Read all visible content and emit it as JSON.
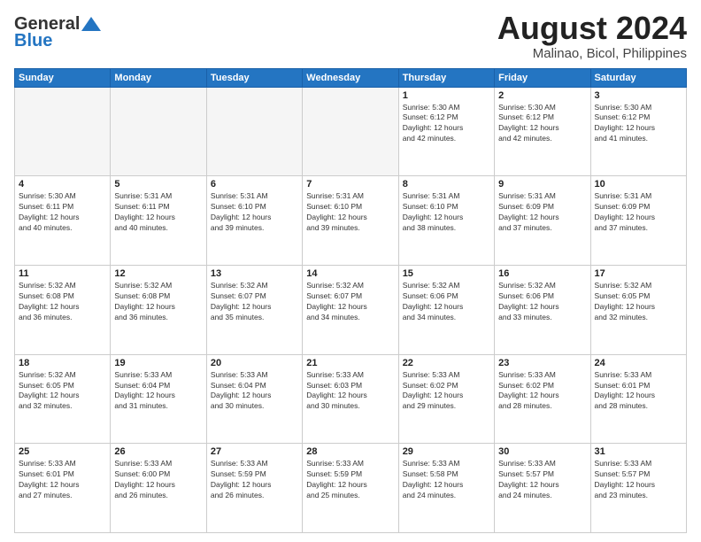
{
  "header": {
    "logo_line1": "General",
    "logo_line2": "Blue",
    "title": "August 2024",
    "subtitle": "Malinao, Bicol, Philippines"
  },
  "weekdays": [
    "Sunday",
    "Monday",
    "Tuesday",
    "Wednesday",
    "Thursday",
    "Friday",
    "Saturday"
  ],
  "weeks": [
    [
      {
        "day": "",
        "info": ""
      },
      {
        "day": "",
        "info": ""
      },
      {
        "day": "",
        "info": ""
      },
      {
        "day": "",
        "info": ""
      },
      {
        "day": "1",
        "info": "Sunrise: 5:30 AM\nSunset: 6:12 PM\nDaylight: 12 hours\nand 42 minutes."
      },
      {
        "day": "2",
        "info": "Sunrise: 5:30 AM\nSunset: 6:12 PM\nDaylight: 12 hours\nand 42 minutes."
      },
      {
        "day": "3",
        "info": "Sunrise: 5:30 AM\nSunset: 6:12 PM\nDaylight: 12 hours\nand 41 minutes."
      }
    ],
    [
      {
        "day": "4",
        "info": "Sunrise: 5:30 AM\nSunset: 6:11 PM\nDaylight: 12 hours\nand 40 minutes."
      },
      {
        "day": "5",
        "info": "Sunrise: 5:31 AM\nSunset: 6:11 PM\nDaylight: 12 hours\nand 40 minutes."
      },
      {
        "day": "6",
        "info": "Sunrise: 5:31 AM\nSunset: 6:10 PM\nDaylight: 12 hours\nand 39 minutes."
      },
      {
        "day": "7",
        "info": "Sunrise: 5:31 AM\nSunset: 6:10 PM\nDaylight: 12 hours\nand 39 minutes."
      },
      {
        "day": "8",
        "info": "Sunrise: 5:31 AM\nSunset: 6:10 PM\nDaylight: 12 hours\nand 38 minutes."
      },
      {
        "day": "9",
        "info": "Sunrise: 5:31 AM\nSunset: 6:09 PM\nDaylight: 12 hours\nand 37 minutes."
      },
      {
        "day": "10",
        "info": "Sunrise: 5:31 AM\nSunset: 6:09 PM\nDaylight: 12 hours\nand 37 minutes."
      }
    ],
    [
      {
        "day": "11",
        "info": "Sunrise: 5:32 AM\nSunset: 6:08 PM\nDaylight: 12 hours\nand 36 minutes."
      },
      {
        "day": "12",
        "info": "Sunrise: 5:32 AM\nSunset: 6:08 PM\nDaylight: 12 hours\nand 36 minutes."
      },
      {
        "day": "13",
        "info": "Sunrise: 5:32 AM\nSunset: 6:07 PM\nDaylight: 12 hours\nand 35 minutes."
      },
      {
        "day": "14",
        "info": "Sunrise: 5:32 AM\nSunset: 6:07 PM\nDaylight: 12 hours\nand 34 minutes."
      },
      {
        "day": "15",
        "info": "Sunrise: 5:32 AM\nSunset: 6:06 PM\nDaylight: 12 hours\nand 34 minutes."
      },
      {
        "day": "16",
        "info": "Sunrise: 5:32 AM\nSunset: 6:06 PM\nDaylight: 12 hours\nand 33 minutes."
      },
      {
        "day": "17",
        "info": "Sunrise: 5:32 AM\nSunset: 6:05 PM\nDaylight: 12 hours\nand 32 minutes."
      }
    ],
    [
      {
        "day": "18",
        "info": "Sunrise: 5:32 AM\nSunset: 6:05 PM\nDaylight: 12 hours\nand 32 minutes."
      },
      {
        "day": "19",
        "info": "Sunrise: 5:33 AM\nSunset: 6:04 PM\nDaylight: 12 hours\nand 31 minutes."
      },
      {
        "day": "20",
        "info": "Sunrise: 5:33 AM\nSunset: 6:04 PM\nDaylight: 12 hours\nand 30 minutes."
      },
      {
        "day": "21",
        "info": "Sunrise: 5:33 AM\nSunset: 6:03 PM\nDaylight: 12 hours\nand 30 minutes."
      },
      {
        "day": "22",
        "info": "Sunrise: 5:33 AM\nSunset: 6:02 PM\nDaylight: 12 hours\nand 29 minutes."
      },
      {
        "day": "23",
        "info": "Sunrise: 5:33 AM\nSunset: 6:02 PM\nDaylight: 12 hours\nand 28 minutes."
      },
      {
        "day": "24",
        "info": "Sunrise: 5:33 AM\nSunset: 6:01 PM\nDaylight: 12 hours\nand 28 minutes."
      }
    ],
    [
      {
        "day": "25",
        "info": "Sunrise: 5:33 AM\nSunset: 6:01 PM\nDaylight: 12 hours\nand 27 minutes."
      },
      {
        "day": "26",
        "info": "Sunrise: 5:33 AM\nSunset: 6:00 PM\nDaylight: 12 hours\nand 26 minutes."
      },
      {
        "day": "27",
        "info": "Sunrise: 5:33 AM\nSunset: 5:59 PM\nDaylight: 12 hours\nand 26 minutes."
      },
      {
        "day": "28",
        "info": "Sunrise: 5:33 AM\nSunset: 5:59 PM\nDaylight: 12 hours\nand 25 minutes."
      },
      {
        "day": "29",
        "info": "Sunrise: 5:33 AM\nSunset: 5:58 PM\nDaylight: 12 hours\nand 24 minutes."
      },
      {
        "day": "30",
        "info": "Sunrise: 5:33 AM\nSunset: 5:57 PM\nDaylight: 12 hours\nand 24 minutes."
      },
      {
        "day": "31",
        "info": "Sunrise: 5:33 AM\nSunset: 5:57 PM\nDaylight: 12 hours\nand 23 minutes."
      }
    ]
  ]
}
